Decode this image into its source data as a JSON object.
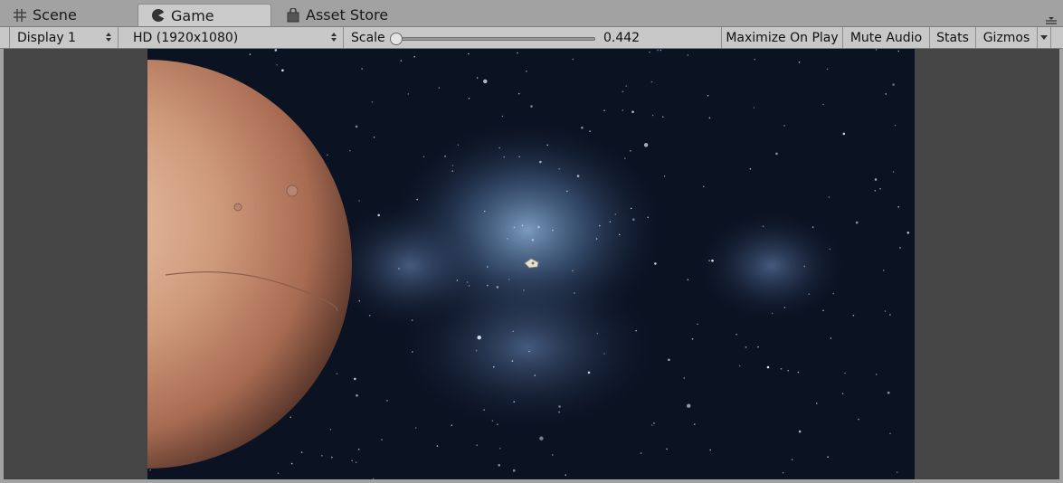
{
  "tabs": [
    {
      "label": "Scene",
      "icon": "grid-icon",
      "active": false
    },
    {
      "label": "Game",
      "icon": "pacman-icon",
      "active": true
    },
    {
      "label": "Asset Store",
      "icon": "shopping-bag-icon",
      "active": false
    }
  ],
  "toolbar": {
    "display": "Display 1",
    "resolution": "HD (1920x1080)",
    "scale_label": "Scale",
    "scale_value": "0.442",
    "maximize_label": "Maximize On Play",
    "mute_label": "Mute Audio",
    "stats_label": "Stats",
    "gizmos_label": "Gizmos"
  },
  "game_view": {
    "scene": "space background with nebula and stars",
    "objects": [
      "planet",
      "spaceship"
    ]
  },
  "colors": {
    "window_bg": "#a2a2a2",
    "toolbar_bg": "#c8c8c8",
    "viewport_bg": "#454545",
    "space_bg": "#0c1322",
    "planet": "#c7876a"
  }
}
